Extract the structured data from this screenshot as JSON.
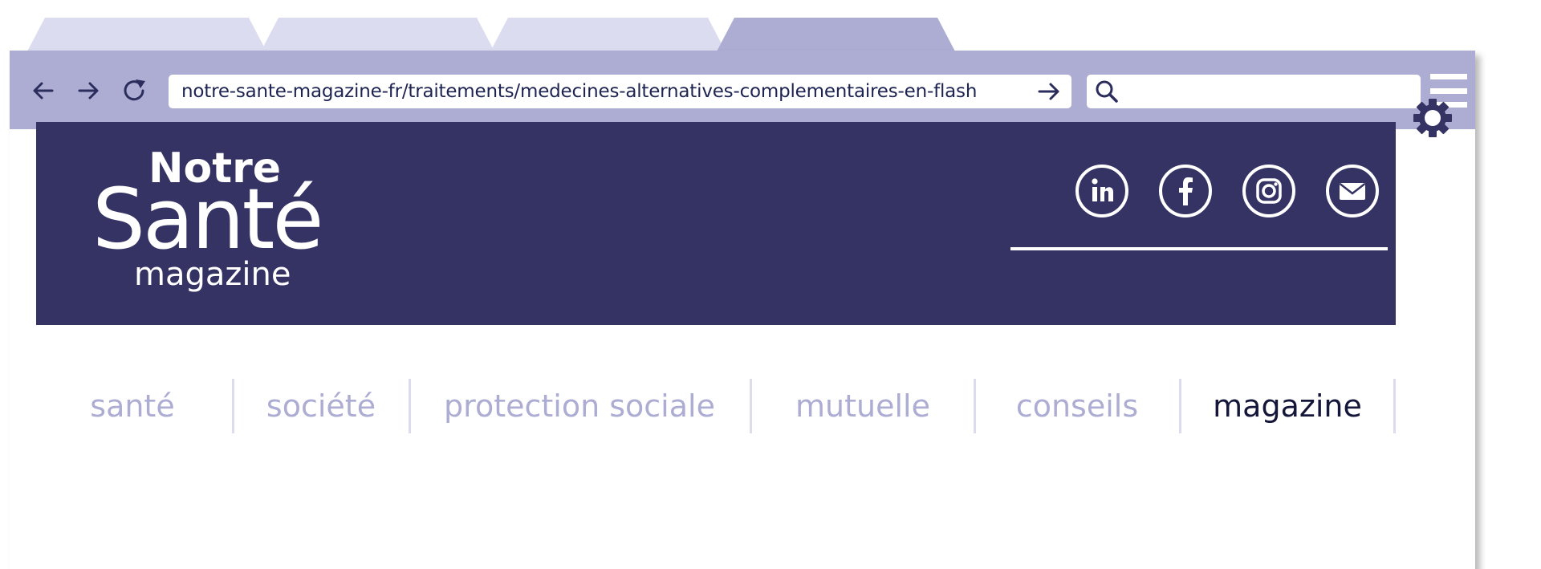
{
  "browser": {
    "url": "notre-sante-magazine-fr/traitements/medecines-alternatives-complementaires-en-flash",
    "search_value": "",
    "tabs": [
      "",
      "",
      "",
      ""
    ]
  },
  "site": {
    "logo": {
      "line1": "Notre",
      "line2": "Santé",
      "line3": "magazine"
    },
    "social": [
      "linkedin-icon",
      "facebook-icon",
      "instagram-icon",
      "mail-icon"
    ]
  },
  "menu": {
    "items": [
      {
        "label": "santé"
      },
      {
        "label": "société"
      },
      {
        "label": "protection sociale"
      },
      {
        "label": "mutuelle"
      },
      {
        "label": "conseils"
      },
      {
        "label": "magazine"
      }
    ],
    "active_index": 5
  },
  "colors": {
    "toolbar": "#adadd4",
    "tab_inactive": "#dcdcf0",
    "banner": "#353364",
    "menu_inactive": "#adadd4",
    "menu_active": "#14163a"
  }
}
